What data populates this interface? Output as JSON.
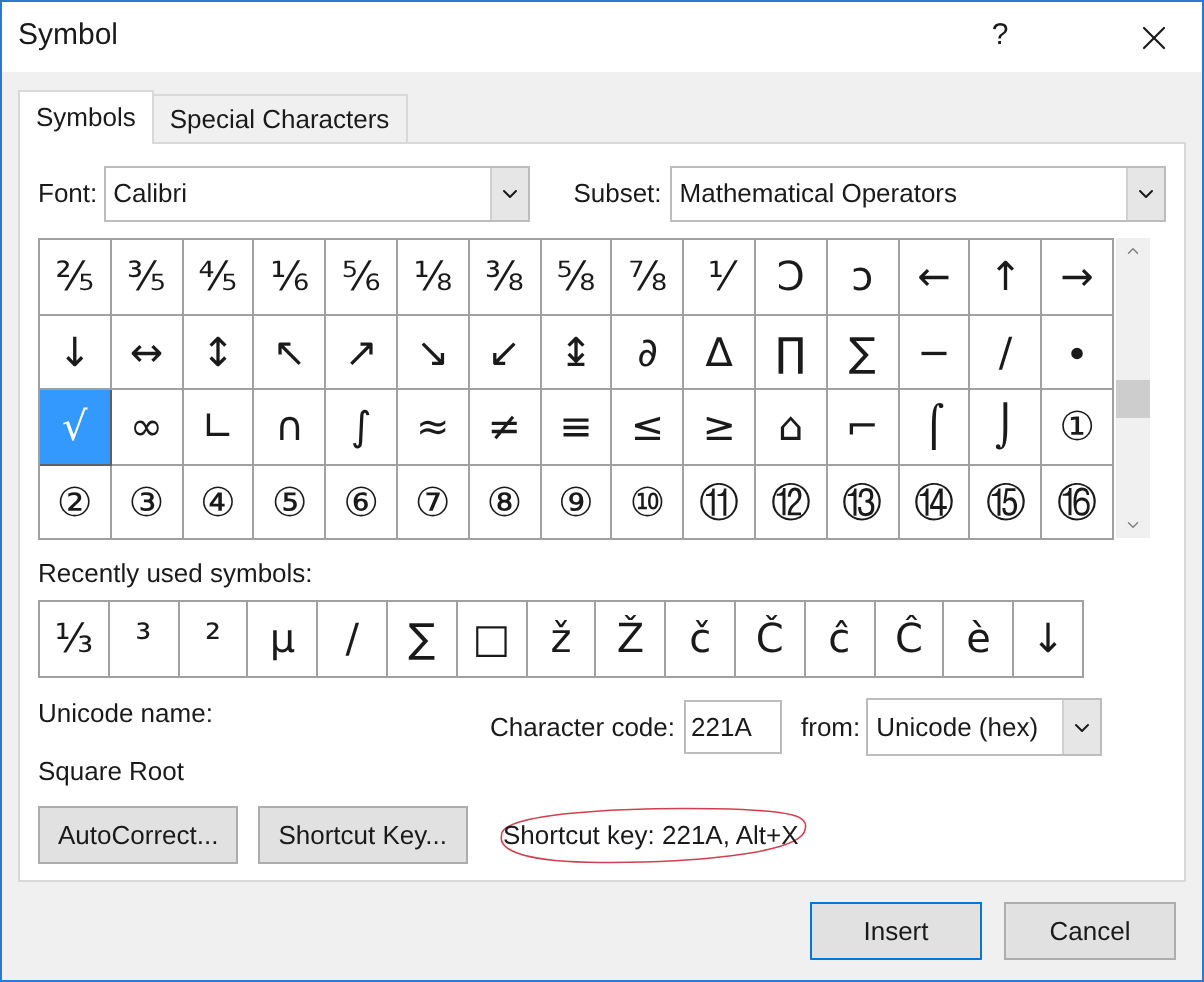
{
  "window": {
    "title": "Symbol",
    "help": "?"
  },
  "tabs": [
    {
      "label": "Symbols",
      "selected": true
    },
    {
      "label": "Special Characters",
      "selected": false
    }
  ],
  "font": {
    "label": "Font:",
    "value": "Calibri"
  },
  "subset": {
    "label": "Subset:",
    "value": "Mathematical Operators"
  },
  "symbol_grid": [
    [
      {
        "char": "⅖",
        "selected": false
      },
      {
        "char": "⅗",
        "selected": false
      },
      {
        "char": "⅘",
        "selected": false
      },
      {
        "char": "⅙",
        "selected": false
      },
      {
        "char": "⅚",
        "selected": false
      },
      {
        "char": "⅛",
        "selected": false
      },
      {
        "char": "⅜",
        "selected": false
      },
      {
        "char": "⅝",
        "selected": false
      },
      {
        "char": "⅞",
        "selected": false
      },
      {
        "char": "⅟",
        "selected": false
      },
      {
        "char": "Ↄ",
        "selected": false
      },
      {
        "char": "ↄ",
        "selected": false
      },
      {
        "char": "←",
        "selected": false
      },
      {
        "char": "↑",
        "selected": false
      },
      {
        "char": "→",
        "selected": false
      }
    ],
    [
      {
        "char": "↓",
        "selected": false
      },
      {
        "char": "↔",
        "selected": false
      },
      {
        "char": "↕",
        "selected": false
      },
      {
        "char": "↖",
        "selected": false
      },
      {
        "char": "↗",
        "selected": false
      },
      {
        "char": "↘",
        "selected": false
      },
      {
        "char": "↙",
        "selected": false
      },
      {
        "char": "↨",
        "selected": false
      },
      {
        "char": "∂",
        "selected": false
      },
      {
        "char": "∆",
        "selected": false
      },
      {
        "char": "∏",
        "selected": false
      },
      {
        "char": "∑",
        "selected": false
      },
      {
        "char": "−",
        "selected": false
      },
      {
        "char": "∕",
        "selected": false
      },
      {
        "char": "∙",
        "selected": false
      }
    ],
    [
      {
        "char": "√",
        "selected": true
      },
      {
        "char": "∞",
        "selected": false
      },
      {
        "char": "∟",
        "selected": false
      },
      {
        "char": "∩",
        "selected": false
      },
      {
        "char": "∫",
        "selected": false
      },
      {
        "char": "≈",
        "selected": false
      },
      {
        "char": "≠",
        "selected": false
      },
      {
        "char": "≡",
        "selected": false
      },
      {
        "char": "≤",
        "selected": false
      },
      {
        "char": "≥",
        "selected": false
      },
      {
        "char": "⌂",
        "selected": false
      },
      {
        "char": "⌐",
        "selected": false
      },
      {
        "char": "⌠",
        "selected": false
      },
      {
        "char": "⌡",
        "selected": false
      },
      {
        "char": "①",
        "selected": false
      }
    ],
    [
      {
        "char": "②",
        "selected": false
      },
      {
        "char": "③",
        "selected": false
      },
      {
        "char": "④",
        "selected": false
      },
      {
        "char": "⑤",
        "selected": false
      },
      {
        "char": "⑥",
        "selected": false
      },
      {
        "char": "⑦",
        "selected": false
      },
      {
        "char": "⑧",
        "selected": false
      },
      {
        "char": "⑨",
        "selected": false
      },
      {
        "char": "⑩",
        "selected": false
      },
      {
        "char": "⑪",
        "selected": false
      },
      {
        "char": "⑫",
        "selected": false
      },
      {
        "char": "⑬",
        "selected": false
      },
      {
        "char": "⑭",
        "selected": false
      },
      {
        "char": "⑮",
        "selected": false
      },
      {
        "char": "⑯",
        "selected": false
      }
    ]
  ],
  "recent": {
    "label": "Recently used symbols:",
    "symbols": [
      "⅓",
      "³",
      "²",
      "µ",
      "∕",
      "∑",
      "□",
      "ž",
      "Ž",
      "č",
      "Č",
      "ĉ",
      "Ĉ",
      "è",
      "↓"
    ]
  },
  "unicode_name": {
    "label": "Unicode name:",
    "value": "Square Root"
  },
  "character_code": {
    "label": "Character code:",
    "value": "221A"
  },
  "from": {
    "label": "from:",
    "value": "Unicode (hex)"
  },
  "buttons": [
    "AutoCorrect...",
    "Shortcut Key..."
  ],
  "shortcut_text": "Shortcut key: 221A, Alt+X",
  "dialog_buttons": [
    {
      "label": "Insert",
      "default": true
    },
    {
      "label": "Cancel",
      "default": false
    }
  ]
}
